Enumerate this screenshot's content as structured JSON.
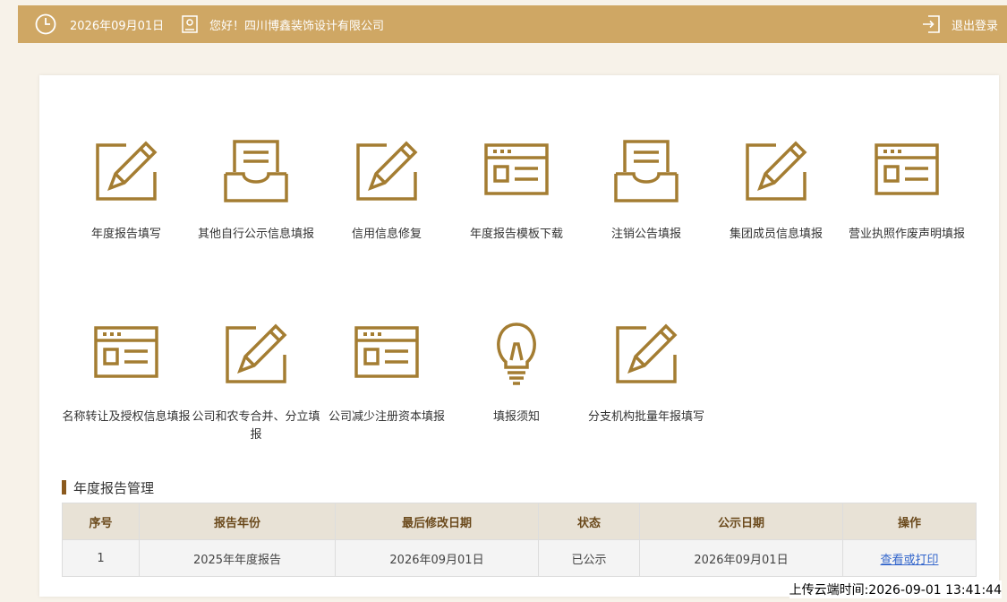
{
  "header": {
    "date": "2026年09月01日",
    "greeting": "您好！四川博鑫装饰设计有限公司",
    "logout": "退出登录"
  },
  "tiles": [
    {
      "label": "年度报告填写",
      "icon": "edit-icon"
    },
    {
      "label": "其他自行公示信息填报",
      "icon": "inbox-icon"
    },
    {
      "label": "信用信息修复",
      "icon": "edit-icon"
    },
    {
      "label": "年度报告模板下载",
      "icon": "window-icon"
    },
    {
      "label": "注销公告填报",
      "icon": "inbox-icon"
    },
    {
      "label": "集团成员信息填报",
      "icon": "edit-icon"
    },
    {
      "label": "营业执照作废声明填报",
      "icon": "window-icon"
    },
    {
      "label": "名称转让及授权信息填报",
      "icon": "window-icon"
    },
    {
      "label": "公司和农专合并、分立填报",
      "icon": "edit-icon"
    },
    {
      "label": "公司减少注册资本填报",
      "icon": "window-icon"
    },
    {
      "label": "填报须知",
      "icon": "lightbulb-icon"
    },
    {
      "label": "分支机构批量年报填写",
      "icon": "edit-icon"
    }
  ],
  "section": {
    "title": "年度报告管理"
  },
  "table": {
    "headers": [
      "序号",
      "报告年份",
      "最后修改日期",
      "状态",
      "公示日期",
      "操作"
    ],
    "rows": [
      [
        "1",
        "2025年年度报告",
        "2026年09月01日",
        "已公示",
        "2026年09月01日",
        "查看或打印"
      ]
    ]
  },
  "footer": {
    "upload_time": "上传云端时间:2026-09-01 13:41:44"
  },
  "colors": {
    "accent": "#cfa764",
    "icon": "#a47d32",
    "link": "#3366cc"
  }
}
